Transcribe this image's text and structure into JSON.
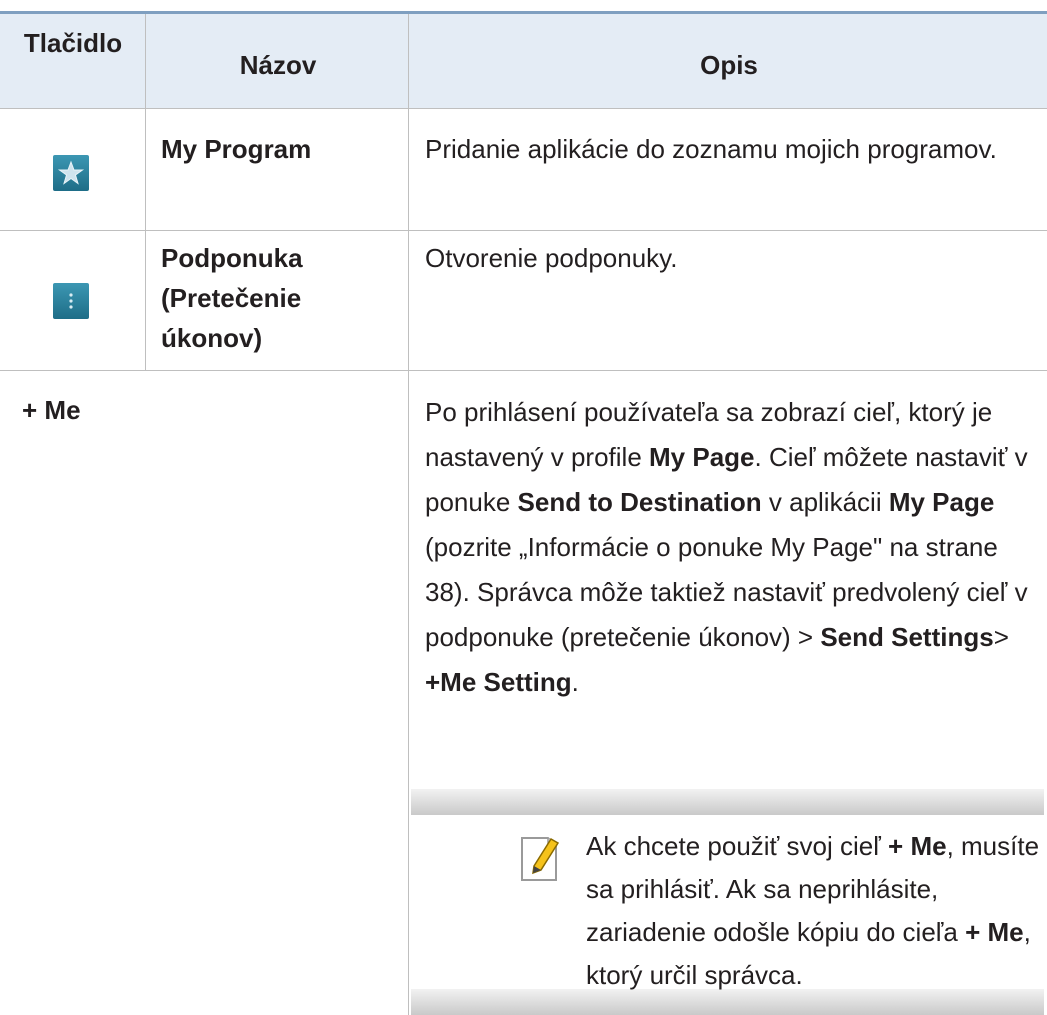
{
  "table": {
    "headers": {
      "button": "Tlačidlo",
      "name": "Názov",
      "description": "Opis"
    },
    "rows": [
      {
        "icon": "star-icon",
        "name": "My Program",
        "description": "Pridanie aplikácie do zoznamu mojich programov."
      },
      {
        "icon": "overflow-menu-icon",
        "name": "Podponuka (Pretečenie úkonov)",
        "description": "Otvorenie podponuky."
      },
      {
        "name": "+ Me",
        "description": {
          "t1": "Po prihlásení používateľa sa zobrazí cieľ, ktorý je nastavený v profile ",
          "b1": "My Page",
          "t2": ". Cieľ môžete nastaviť v ponuke ",
          "b2": "Send to Destination",
          "t3": " v aplikácii ",
          "b3": "My Page",
          "t4": " (pozrite „Informácie o ponuke My Page\" na strane 38). Správca môže taktiež nastaviť predvolený cieľ v podponuke (pretečenie úkonov) > ",
          "b4": "Send Settings",
          "t5": "> ",
          "b5": "+Me Setting",
          "t6": "."
        },
        "note": {
          "icon": "note-pencil-icon",
          "t1": "Ak chcete použiť svoj cieľ ",
          "b1": "+ Me",
          "t2": ", musíte sa prihlásiť. Ak sa neprihlásite, zariadenie odošle kópiu do cieľa ",
          "b2": "+ Me",
          "t3": ", ktorý určil správca."
        }
      }
    ]
  },
  "colors": {
    "header_bg": "#e4ecf5",
    "rule": "#7f9fc0",
    "grid": "#bfbfbf",
    "icon": "#2a7f9b"
  }
}
